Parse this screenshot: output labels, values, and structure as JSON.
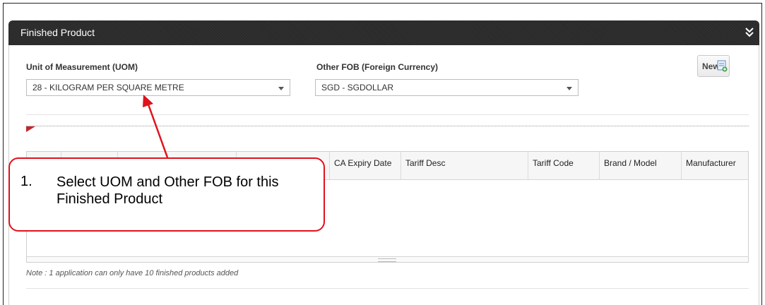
{
  "panel": {
    "title": "Finished Product",
    "collapse_icon": "double-chevron-down-icon"
  },
  "uom": {
    "label": "Unit of Measurement (UOM)",
    "selected": "28 - KILOGRAM PER SQUARE METRE"
  },
  "fob": {
    "label": "Other FOB (Foreign Currency)",
    "selected": "SGD - SGDOLLAR"
  },
  "new_button": {
    "label": "New",
    "icon": "new-document-icon"
  },
  "grid": {
    "columns": [
      "",
      "",
      "",
      "",
      "CA Expiry Date",
      "Tariff Desc",
      "Tariff Code",
      "Brand / Model",
      "Manufacturer"
    ],
    "rows": []
  },
  "note": "Note : 1 application can only have 10 finished products added",
  "callout": {
    "number": "1.",
    "text": "Select UOM and Other FOB for this Finished Product"
  },
  "colors": {
    "header_bg": "#2a2a2a",
    "callout_border": "#e0121b",
    "flag": "#c0272d"
  }
}
